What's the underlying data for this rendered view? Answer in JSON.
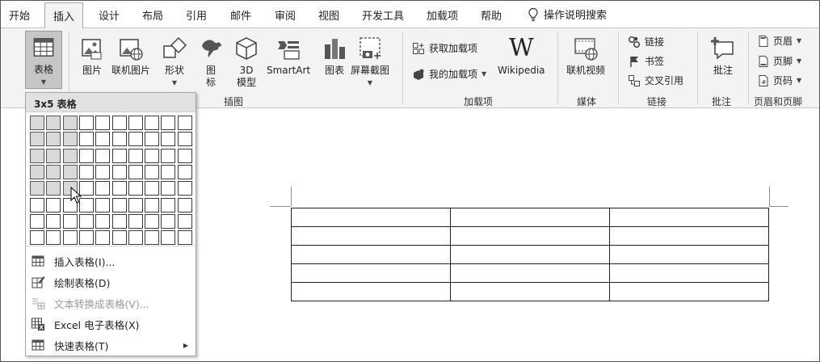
{
  "tabs": [
    "开始",
    "插入",
    "设计",
    "布局",
    "引用",
    "邮件",
    "审阅",
    "视图",
    "开发工具",
    "加载项",
    "帮助"
  ],
  "tell_me": "操作说明搜索",
  "ribbon": {
    "table_button": "表格",
    "illustrations": {
      "picture": "图片",
      "online_picture": "联机图片",
      "shapes": "形状",
      "icons_line1": "图",
      "icons_line2": "标",
      "model_line1": "3D",
      "model_line2": "模型",
      "smartart": "SmartArt",
      "chart": "图表",
      "screenshot": "屏幕截图",
      "group_label": "插图"
    },
    "addins": {
      "get_addins": "获取加载项",
      "my_addins": "我的加载项",
      "wikipedia_logo": "W",
      "wikipedia": "Wikipedia",
      "group_label": "加载项"
    },
    "media": {
      "online_video": "联机视频",
      "group_label": "媒体"
    },
    "links": {
      "link": "链接",
      "bookmark": "书签",
      "cross_ref": "交叉引用",
      "group_label": "链接"
    },
    "comments": {
      "comment": "批注",
      "group_label": "批注"
    },
    "header_footer": {
      "header": "页眉",
      "footer": "页脚",
      "page_number": "页码",
      "group_label": "页眉和页脚"
    }
  },
  "dropdown": {
    "title": "3x5 表格",
    "grid": {
      "columns": 10,
      "rows": 8,
      "selected_columns": 3,
      "selected_rows": 5
    },
    "menu": [
      {
        "label": "插入表格(I)...",
        "icon": "insert-table-icon",
        "disabled": false
      },
      {
        "label": "绘制表格(D)",
        "icon": "draw-table-icon",
        "disabled": false
      },
      {
        "label": "文本转换成表格(V)...",
        "icon": "text-to-table-icon",
        "disabled": true
      },
      {
        "label": "Excel 电子表格(X)",
        "icon": "excel-table-icon",
        "disabled": false
      },
      {
        "label": "快速表格(T)",
        "icon": "quick-table-icon",
        "disabled": false
      }
    ]
  },
  "document": {
    "table": {
      "rows": 5,
      "columns": 3
    }
  },
  "colors": {
    "ribbon_bg": "#f3f3f3",
    "selected_button": "#c6c6c6",
    "grid_selected": "#d9d9d9"
  }
}
